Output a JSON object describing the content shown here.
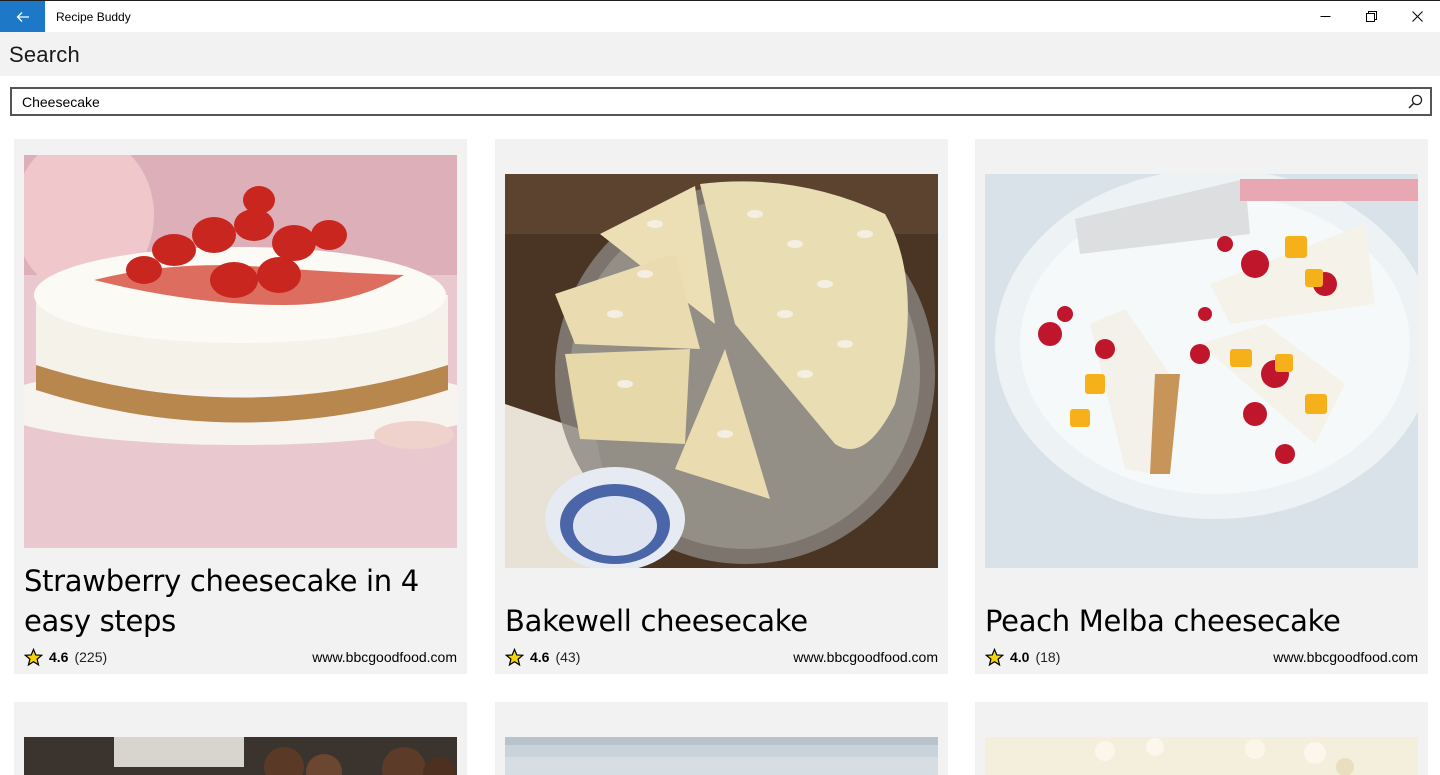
{
  "app": {
    "title": "Recipe Buddy"
  },
  "header": {
    "title": "Search"
  },
  "search": {
    "value": "Cheesecake",
    "placeholder": ""
  },
  "results": [
    {
      "title": "Strawberry cheesecake in 4 easy steps",
      "rating": "4.6",
      "count": "(225)",
      "source": "www.bbcgoodfood.com",
      "image": "strawberry-cheesecake-photo"
    },
    {
      "title": "Bakewell cheesecake",
      "rating": "4.6",
      "count": "(43)",
      "source": "www.bbcgoodfood.com",
      "image": "bakewell-cheesecake-photo"
    },
    {
      "title": "Peach Melba cheesecake",
      "rating": "4.0",
      "count": "(18)",
      "source": "www.bbcgoodfood.com",
      "image": "peach-melba-cheesecake-photo"
    }
  ],
  "colors": {
    "accent": "#1e78c8",
    "card_bg": "#f2f2f2",
    "header_bg": "#f2f2f2",
    "star": "#f5d40f"
  }
}
